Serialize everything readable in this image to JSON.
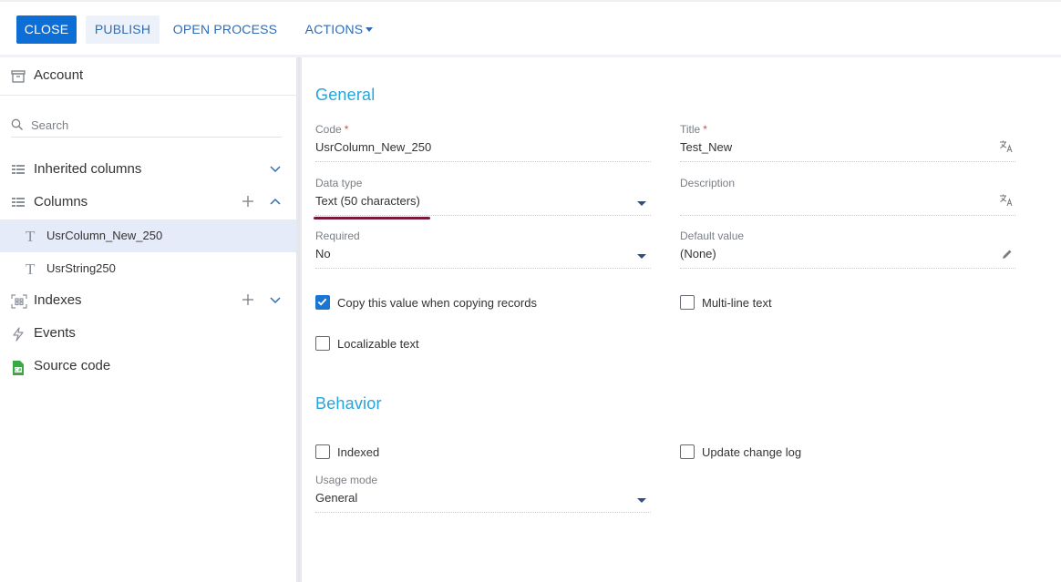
{
  "toolbar": {
    "close": "CLOSE",
    "publish": "PUBLISH",
    "open_process": "OPEN PROCESS",
    "actions": "ACTIONS"
  },
  "sidebar": {
    "title": "Account",
    "search_placeholder": "Search",
    "inherited": "Inherited columns",
    "columns": "Columns",
    "column_items": [
      "UsrColumn_New_250",
      "UsrString250"
    ],
    "indexes": "Indexes",
    "events": "Events",
    "source_code": "Source code"
  },
  "general": {
    "title": "General",
    "code_label": "Code",
    "code_value": "UsrColumn_New_250",
    "title_label": "Title",
    "title_value": "Test_New",
    "datatype_label": "Data type",
    "datatype_value": "Text (50 characters)",
    "description_label": "Description",
    "description_value": "",
    "required_label": "Required",
    "required_value": "No",
    "default_label": "Default value",
    "default_value": "(None)",
    "required_marker": "*",
    "copy_value": "Copy this value when copying records",
    "multiline": "Multi-line text",
    "localizable": "Localizable text"
  },
  "behavior": {
    "title": "Behavior",
    "indexed": "Indexed",
    "update_log": "Update change log",
    "usage_label": "Usage mode",
    "usage_value": "General"
  },
  "state": {
    "copy_value_checked": true,
    "multiline_checked": false,
    "localizable_checked": false,
    "indexed_checked": false,
    "update_log_checked": false
  },
  "colors": {
    "primary": "#0d6fd6",
    "section_title": "#2aa3d9",
    "link": "#2f6cb5",
    "selected_row": "#e5ebf8",
    "required": "#e3443b",
    "annotation": "#7a1a3a"
  }
}
